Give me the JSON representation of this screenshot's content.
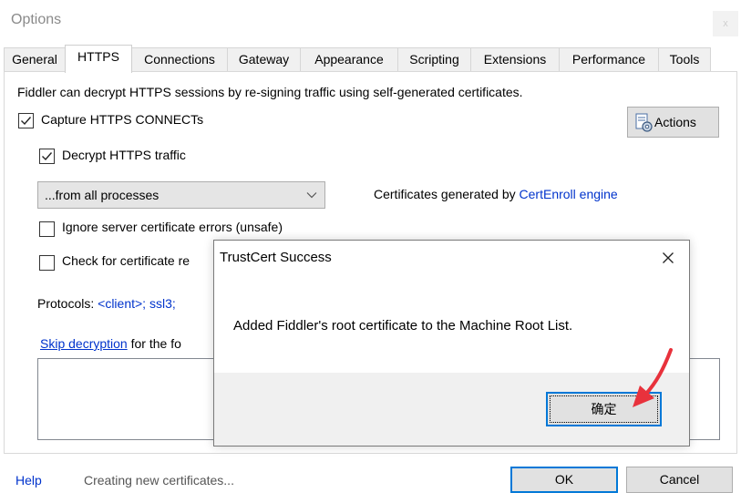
{
  "window": {
    "title": "Options",
    "close_label": "x"
  },
  "tabs": [
    {
      "label": "General",
      "active": false
    },
    {
      "label": "HTTPS",
      "active": true
    },
    {
      "label": "Connections",
      "active": false
    },
    {
      "label": "Gateway",
      "active": false
    },
    {
      "label": "Appearance",
      "active": false
    },
    {
      "label": "Scripting",
      "active": false
    },
    {
      "label": "Extensions",
      "active": false
    },
    {
      "label": "Performance",
      "active": false
    },
    {
      "label": "Tools",
      "active": false
    }
  ],
  "https": {
    "description": "Fiddler can decrypt HTTPS sessions by re-signing traffic using self-generated certificates.",
    "capture_connects": {
      "label": "Capture HTTPS CONNECTs",
      "checked": true
    },
    "actions_label": "Actions",
    "decrypt_traffic": {
      "label": "Decrypt HTTPS traffic",
      "checked": true
    },
    "process_filter": {
      "value": "...from all processes"
    },
    "cert_generator_prefix": "Certificates generated by ",
    "cert_generator_link": "CertEnroll engine",
    "ignore_errors": {
      "label": "Ignore server certificate errors (unsafe)",
      "checked": false
    },
    "check_revocation": {
      "label": "Check for certificate re",
      "checked": false
    },
    "protocols_label": "Protocols: ",
    "protocols_value": "<client>; ssl3;",
    "skip_decryption_link": "Skip decryption",
    "skip_decryption_suffix": " for the fo"
  },
  "bottom": {
    "help_label": "Help",
    "status": "Creating new certificates...",
    "ok_label": "OK",
    "cancel_label": "Cancel"
  },
  "trust_dialog": {
    "title": "TrustCert Success",
    "message": "Added Fiddler's root certificate to the Machine Root List.",
    "ok_label": "确定"
  },
  "colors": {
    "link": "#0033cc",
    "focus": "#0078d7",
    "annotation_arrow": "#e8323c"
  },
  "icons": {
    "actions": "certificate-gear-icon",
    "dropdown": "chevron-down-icon",
    "close": "close-icon"
  }
}
